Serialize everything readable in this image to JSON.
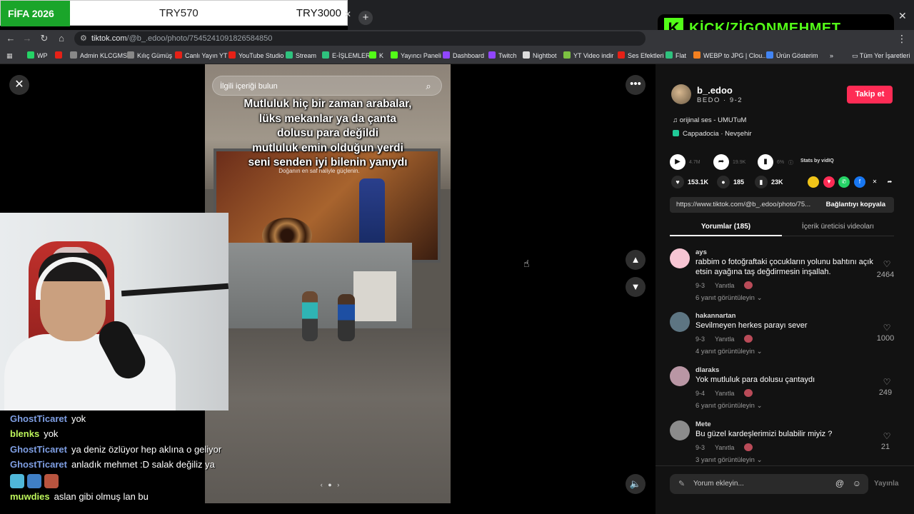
{
  "overlay": {
    "tag": "FİFA 2026",
    "price1": "TRY570",
    "price2": "TRY3000",
    "kick_label": "KİCK/ZİGONMEHMET"
  },
  "browser": {
    "url_host": "tiktok.com",
    "url_path": "/@b_.edoo/photo/7545241091826584850",
    "bookmarks": [
      {
        "label": "WP",
        "color": "#25d366"
      },
      {
        "label": "",
        "color": "#e62117"
      },
      {
        "label": "Admin KLCGMS",
        "color": "#888888"
      },
      {
        "label": "Kılıç Gümüş",
        "color": "#888888"
      },
      {
        "label": "Canlı Yayın YT",
        "color": "#e62117"
      },
      {
        "label": "YouTube Studio",
        "color": "#e62117"
      },
      {
        "label": "Stream",
        "color": "#2ec27e"
      },
      {
        "label": "E-İŞLEMLER",
        "color": "#2ec27e"
      },
      {
        "label": "K",
        "color": "#53fc18"
      },
      {
        "label": "Yayıncı Paneli",
        "color": "#53fc18"
      },
      {
        "label": "Dashboard",
        "color": "#9146ff"
      },
      {
        "label": "Twitch",
        "color": "#9146ff"
      },
      {
        "label": "Nightbot",
        "color": "#dddddd"
      },
      {
        "label": "YT Video indir",
        "color": "#7cc242"
      },
      {
        "label": "Ses Efektleri",
        "color": "#e62117"
      },
      {
        "label": "Flat",
        "color": "#2ec27e"
      },
      {
        "label": "WEBP to JPG | Clou...",
        "color": "#f38020"
      },
      {
        "label": "Ürün Gösterim",
        "color": "#4285f4"
      },
      {
        "label": "»",
        "color": ""
      },
      {
        "label": "Tüm Yer İşaretleri",
        "color": ""
      }
    ]
  },
  "viewer": {
    "search_placeholder": "İlgili içeriği bulun",
    "photo_text": "Mutluluk hiç bir zaman arabalar,\nlüks mekanlar ya da çanta\ndolusu para değildi\nmutluluk emin olduğun yerdi\nseni senden iyi bilenin yanıydı",
    "photo_subtext": "Doğanın en saf haliyle güçlenin."
  },
  "chat": [
    {
      "user": "GhostTicaret",
      "color": "#7f9fe4",
      "text": "yok"
    },
    {
      "user": "blenks",
      "color": "#bdf55b",
      "text": "yok"
    },
    {
      "user": "GhostTicaret",
      "color": "#7f9fe4",
      "text": "ya deniz özlüyor hep aklına o geliyor"
    },
    {
      "user": "GhostTicaret",
      "color": "#7f9fe4",
      "text": "anladık mehmet :D salak değiliz ya"
    },
    {
      "user": "muwdies",
      "color": "#bdf55b",
      "text": "aslan gibi olmuş lan bu"
    }
  ],
  "post": {
    "username": "b_.edoo",
    "display": "BEDO · 9-2",
    "follow_label": "Takip et",
    "music": "orijinal ses - UMUTuM",
    "location": "Cappadocia · Nevşehir",
    "stats": {
      "plays": "4.7M",
      "shares": "19.9K",
      "pct": "6%",
      "stats_by": "Stats by vidIQ"
    },
    "likes": "153.1K",
    "comments": "185",
    "saves": "23K",
    "link": "https://www.tiktok.com/@b_.edoo/photo/75...",
    "copy_label": "Bağlantıyı kopyala",
    "tab_comments": "Yorumlar (185)",
    "tab_creator": "İçerik üreticisi videoları"
  },
  "comments": [
    {
      "name": "ays",
      "text": "rabbim o fotoğraftaki çocukların yolunu bahtını açık etsin ayağına taş değdirmesin inşallah.",
      "date": "9-3",
      "reply": "Yanıtla",
      "more": "6 yanıt görüntüleyin",
      "likes": "2464",
      "avatar": "#f7c5d3"
    },
    {
      "name": "hakannartan",
      "text": "Sevilmeyen herkes parayı sever",
      "date": "9-3",
      "reply": "Yanıtla",
      "more": "4 yanıt görüntüleyin",
      "likes": "1000",
      "avatar": "#5d7582"
    },
    {
      "name": "dlaraks",
      "text": "Yok mutluluk para dolusu çantaydı",
      "date": "9-4",
      "reply": "Yanıtla",
      "more": "6 yanıt görüntüleyin",
      "likes": "249",
      "avatar": "#b996a4"
    },
    {
      "name": "Mete",
      "text": "Bu güzel kardeşlerimizi bulabilir miyiz ?",
      "date": "9-3",
      "reply": "Yanıtla",
      "more": "3 yanıt görüntüleyin",
      "likes": "21",
      "avatar": "#8b8b8b"
    }
  ],
  "comment_input": {
    "placeholder": "Yorum ekleyin...",
    "post_label": "Yayınla"
  }
}
